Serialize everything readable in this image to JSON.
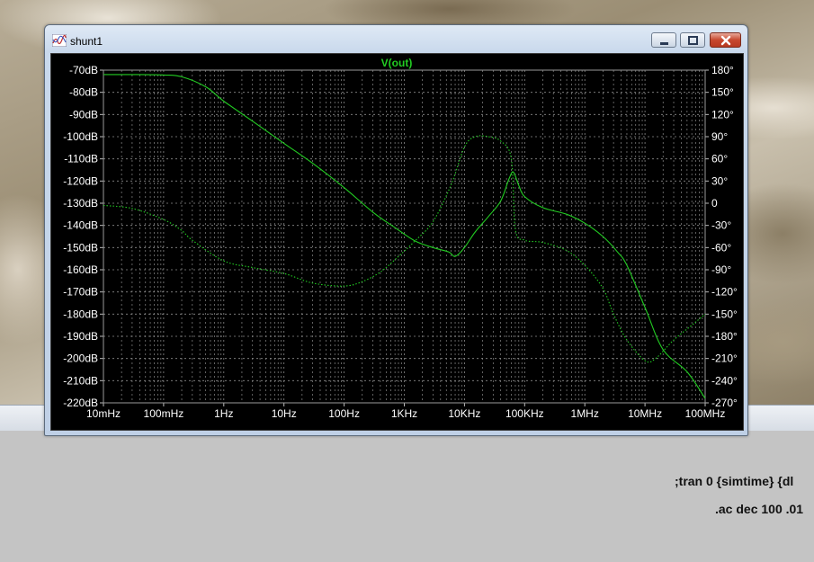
{
  "window": {
    "title": "shunt1",
    "icon": "waveform-icon"
  },
  "directives": {
    "tran": ";tran 0 {simtime} {dl",
    "ac": ".ac dec 100 .01"
  },
  "colors": {
    "trace": "#22cc22",
    "grid": "#8a8a8a",
    "axis_text": "#ffffff",
    "plot_bg": "#000000"
  },
  "chart_data": {
    "type": "line",
    "title": "V(out)",
    "xscale": "log",
    "xlim": [
      0.01,
      100000000
    ],
    "ylim_left": [
      -220,
      -70
    ],
    "ylim_right": [
      -270,
      180
    ],
    "xticks": [
      0.01,
      0.1,
      1,
      10,
      100,
      1000,
      10000,
      100000,
      1000000,
      10000000,
      100000000
    ],
    "xtick_labels": [
      "10mHz",
      "100mHz",
      "1Hz",
      "10Hz",
      "100Hz",
      "1KHz",
      "10KHz",
      "100KHz",
      "1MHz",
      "10MHz",
      "100MHz"
    ],
    "yticks_left": [
      -70,
      -80,
      -90,
      -100,
      -110,
      -120,
      -130,
      -140,
      -150,
      -160,
      -170,
      -180,
      -190,
      -200,
      -210,
      -220
    ],
    "ytick_labels_left": [
      "-70dB",
      "-80dB",
      "-90dB",
      "-100dB",
      "-110dB",
      "-120dB",
      "-130dB",
      "-140dB",
      "-150dB",
      "-160dB",
      "-170dB",
      "-180dB",
      "-190dB",
      "-200dB",
      "-210dB",
      "-220dB"
    ],
    "yticks_right": [
      180,
      150,
      120,
      90,
      60,
      30,
      0,
      -30,
      -60,
      -90,
      -120,
      -150,
      -180,
      -210,
      -240,
      -270
    ],
    "ytick_labels_right": [
      "180°",
      "150°",
      "120°",
      "90°",
      "60°",
      "30°",
      "0",
      "-30°",
      "-60°",
      "-90°",
      "-120°",
      "-150°",
      "-180°",
      "-210°",
      "-240°",
      "-270°"
    ],
    "grid": true,
    "series": [
      {
        "axis": "left",
        "style": "solid",
        "x": [
          0.01,
          0.03,
          0.1,
          0.2,
          0.5,
          1,
          3,
          10,
          30,
          100,
          300,
          700,
          1500,
          3000,
          5500,
          7000,
          10000,
          15000,
          25000,
          40000,
          55000,
          65000,
          80000,
          100000,
          200000,
          500000,
          1000000,
          2000000,
          3500000,
          5000000,
          10000000,
          20000000,
          50000000,
          100000000
        ],
        "y": [
          -72,
          -72,
          -72.2,
          -73,
          -77.5,
          -84,
          -93,
          -103,
          -112,
          -123,
          -134,
          -141,
          -147,
          -150,
          -152,
          -154,
          -150,
          -143,
          -136,
          -129,
          -119,
          -116,
          -122,
          -127,
          -132,
          -135,
          -139,
          -145,
          -152,
          -158,
          -177,
          -196,
          -206,
          -218
        ]
      },
      {
        "axis": "right",
        "style": "dotted",
        "x": [
          0.01,
          0.03,
          0.1,
          0.2,
          0.3,
          1,
          3,
          10,
          30,
          100,
          200,
          400,
          800,
          1500,
          3000,
          6000,
          10000,
          15000,
          25000,
          40000,
          60000,
          70000,
          100000,
          200000,
          500000,
          1000000,
          2000000,
          3000000,
          5000000,
          10000000,
          15000000,
          30000000,
          60000000,
          100000000
        ],
        "y": [
          -3,
          -7,
          -22,
          -37,
          -50,
          -78,
          -87,
          -95,
          -108,
          -112,
          -106,
          -93,
          -72,
          -51,
          -25,
          25,
          76,
          90,
          90,
          84,
          60,
          -35,
          -50,
          -53,
          -64,
          -84,
          -115,
          -150,
          -185,
          -213,
          -210,
          -185,
          -165,
          -150
        ]
      }
    ]
  }
}
